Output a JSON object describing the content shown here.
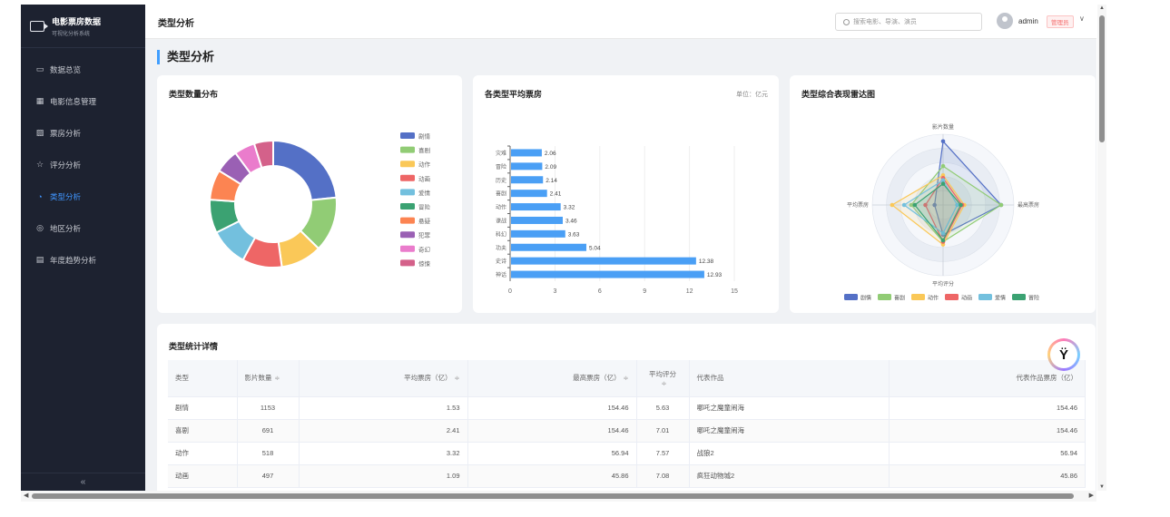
{
  "app": {
    "title": "电影票房数据",
    "subtitle": "可视化分析系统"
  },
  "sidebar": {
    "items": [
      {
        "label": "数据总览",
        "icon": "monitor-icon",
        "glyph": "▭",
        "active": false
      },
      {
        "label": "电影信息管理",
        "icon": "grid-icon",
        "glyph": "▦",
        "active": false
      },
      {
        "label": "票房分析",
        "icon": "chart-icon",
        "glyph": "▨",
        "active": false
      },
      {
        "label": "评分分析",
        "icon": "star-icon",
        "glyph": "☆",
        "active": false
      },
      {
        "label": "类型分析",
        "icon": "pie-icon",
        "glyph": "◔",
        "active": true
      },
      {
        "label": "地区分析",
        "icon": "location-icon",
        "glyph": "◎",
        "active": false
      },
      {
        "label": "年度趋势分析",
        "icon": "calendar-icon",
        "glyph": "▤",
        "active": false
      }
    ],
    "collapse_glyph": "«"
  },
  "header": {
    "title": "类型分析",
    "search_placeholder": "搜索电影、导演、演员",
    "user": "admin",
    "role": "管理员",
    "chevron": "∨"
  },
  "page_title": "类型分析",
  "donut_card": {
    "title": "类型数量分布"
  },
  "bar_card": {
    "title": "各类型平均票房",
    "unit": "单位：亿元"
  },
  "radar_card": {
    "title": "类型综合表现雷达图"
  },
  "chart_data": [
    {
      "type": "pie",
      "title": "类型数量分布",
      "categories": [
        "剧情",
        "喜剧",
        "动作",
        "动画",
        "爱情",
        "冒险",
        "悬疑",
        "犯罪",
        "奇幻",
        "惊悚"
      ],
      "values": [
        1153,
        691,
        518,
        497,
        480,
        420,
        380,
        300,
        260,
        240
      ],
      "colors": [
        "#5470c6",
        "#91cc75",
        "#fac858",
        "#ee6666",
        "#73c0de",
        "#3ba272",
        "#fc8452",
        "#9a60b4",
        "#ea7ccc",
        "#d4618a"
      ],
      "legend": "right"
    },
    {
      "type": "bar",
      "title": "各类型平均票房",
      "orientation": "horizontal",
      "categories": [
        "灾难",
        "冒险",
        "历史",
        "喜剧",
        "动作",
        "谍战",
        "科幻",
        "功夫",
        "史诗",
        "神话"
      ],
      "values": [
        2.06,
        2.09,
        2.14,
        2.41,
        3.32,
        3.46,
        3.63,
        5.04,
        12.38,
        12.93
      ],
      "xlim": [
        0,
        15
      ],
      "xticks": [
        0,
        3,
        6,
        9,
        12,
        15
      ],
      "color": "#4a9ff5",
      "grid": true
    },
    {
      "type": "radar",
      "title": "类型综合表现雷达图",
      "indicators": [
        "影片数量",
        "最高票房",
        "平均评分",
        "平均票房"
      ],
      "series": [
        {
          "name": "剧情",
          "color": "#5470c6",
          "values": [
            0.9,
            0.82,
            0.42,
            0.12
          ]
        },
        {
          "name": "喜剧",
          "color": "#91cc75",
          "values": [
            0.55,
            0.82,
            0.52,
            0.45
          ]
        },
        {
          "name": "动作",
          "color": "#fac858",
          "values": [
            0.42,
            0.3,
            0.56,
            0.72
          ]
        },
        {
          "name": "动画",
          "color": "#ee6666",
          "values": [
            0.38,
            0.27,
            0.52,
            0.25
          ]
        },
        {
          "name": "爱情",
          "color": "#73c0de",
          "values": [
            0.35,
            0.2,
            0.4,
            0.55
          ]
        },
        {
          "name": "冒险",
          "color": "#3ba272",
          "values": [
            0.3,
            0.25,
            0.5,
            0.4
          ]
        }
      ]
    }
  ],
  "table": {
    "title": "类型统计详情",
    "columns": [
      "类型",
      "影片数量",
      "平均票房（亿）",
      "最高票房（亿）",
      "平均评分",
      "代表作品",
      "代表作品票房（亿）"
    ],
    "sort_glyph": "≑",
    "rows": [
      [
        "剧情",
        "1153",
        "1.53",
        "154.46",
        "5.63",
        "哪吒之魔童闹海",
        "154.46"
      ],
      [
        "喜剧",
        "691",
        "2.41",
        "154.46",
        "7.01",
        "哪吒之魔童闹海",
        "154.46"
      ],
      [
        "动作",
        "518",
        "3.32",
        "56.94",
        "7.57",
        "战狼2",
        "56.94"
      ],
      [
        "动画",
        "497",
        "1.09",
        "45.86",
        "7.08",
        "疯狂动物城2",
        "45.86"
      ]
    ]
  },
  "float_logo": {
    "glyph": "Ÿ"
  },
  "scrollbars": {
    "up": "▲",
    "down": "▼",
    "left": "◀",
    "right": "▶"
  }
}
